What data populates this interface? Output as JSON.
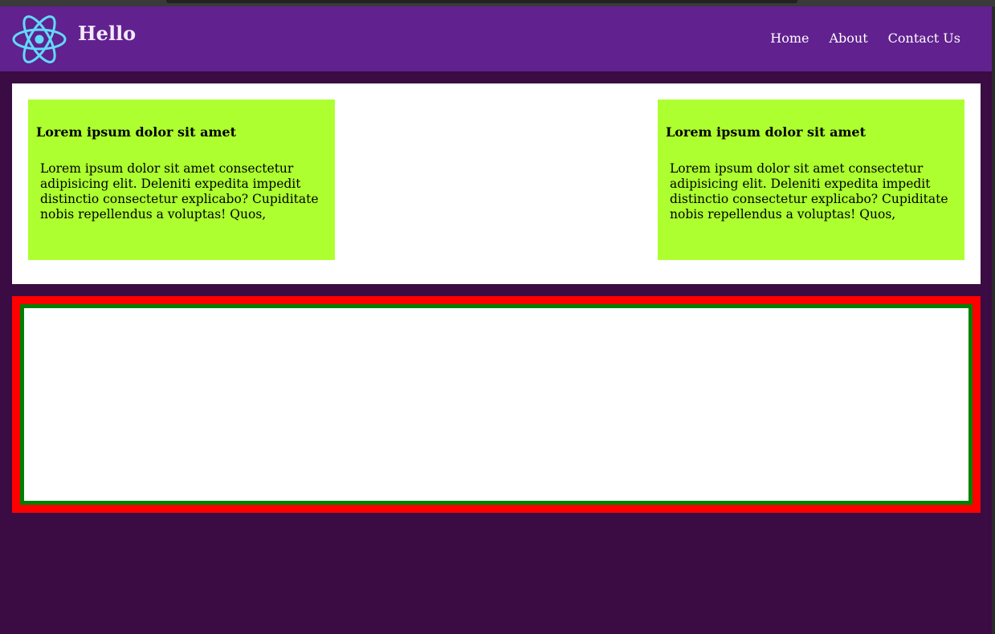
{
  "header": {
    "brand": "Hello",
    "logo_icon": "react-atom-icon",
    "nav": [
      {
        "label": "Home"
      },
      {
        "label": "About"
      },
      {
        "label": "Contact Us"
      }
    ]
  },
  "cards": [
    {
      "title": "Lorem ipsum dolor sit amet",
      "body": "Lorem ipsum dolor sit amet consectetur adipisicing elit. Deleniti expedita impedit distinctio consectetur explicabo? Cupiditate nobis repellendus a voluptas! Quos,"
    },
    {
      "title": "Lorem ipsum dolor sit amet",
      "body": "Lorem ipsum dolor sit amet consectetur adipisicing elit. Deleniti expedita impedit distinctio consectetur explicabo? Cupiditate nobis repellendus a voluptas! Quos,"
    }
  ],
  "colors": {
    "navbar": "#61218f",
    "page_background": "#3b0b43",
    "card": "#adff2f",
    "outer_border": "#ff0000",
    "inner_border": "#008000",
    "logo": "#61dafb"
  }
}
